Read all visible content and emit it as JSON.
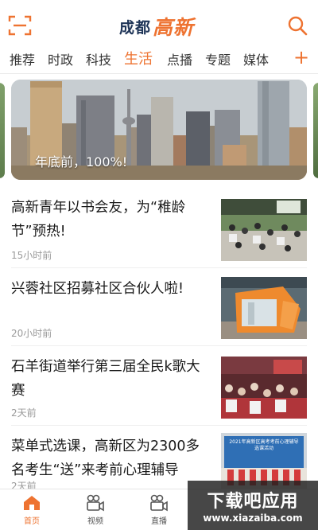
{
  "header": {
    "logo_part1": "成都",
    "logo_part2": "高新",
    "scan_icon": "scan-icon",
    "search_icon": "search-icon"
  },
  "tabs": [
    {
      "label": "推荐"
    },
    {
      "label": "时政"
    },
    {
      "label": "科技"
    },
    {
      "label": "生活"
    },
    {
      "label": "点播"
    },
    {
      "label": "专题"
    },
    {
      "label": "媒体"
    }
  ],
  "active_tab": "生活",
  "tab_add_label": "+",
  "banner": {
    "caption": "年底前，100%!"
  },
  "news": [
    {
      "title": "高新青年以书会友，为“稚龄节”预热!",
      "time": "15小时前"
    },
    {
      "title": "兴蓉社区招募社区合伙人啦!",
      "time": "20小时前"
    },
    {
      "title": "石羊街道举行第三届全民k歌大赛",
      "time": "2天前"
    },
    {
      "title": "菜单式选课，高新区为2300多名考生“送”来考前心理辅导",
      "time": "2天前"
    }
  ],
  "bottom_nav": [
    {
      "label": "首页",
      "icon": "home-icon"
    },
    {
      "label": "视频",
      "icon": "camera-icon"
    },
    {
      "label": "直播",
      "icon": "camera-icon"
    }
  ],
  "active_nav": "首页",
  "watermark": {
    "title": "下载吧应用",
    "url": "www.xiazaiba.com"
  },
  "thumb4_caption": "2021年高新区高考考前心理辅导选课活动",
  "colors": {
    "accent": "#ee7331",
    "logo_dark": "#1f3558",
    "text": "#1a1a1a",
    "muted": "#9a9a9a"
  }
}
